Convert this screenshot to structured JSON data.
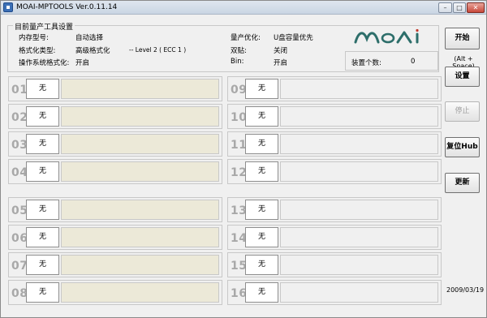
{
  "window": {
    "title": "MOAI-MPTOOLS Ver.0.11.14",
    "controls": [
      "minimize",
      "maximize",
      "close"
    ]
  },
  "settings": {
    "group_title": "目前量产工具设置",
    "memory_type_label": "内存型号:",
    "memory_type_value": "自动选择",
    "format_type_label": "格式化类型:",
    "format_type_value": "高级格式化",
    "level_value": "-- Level 2 ( ECC 1 )",
    "os_format_label": "操作系统格式化:",
    "os_format_value": "开启",
    "optimize_label": "量产优化:",
    "optimize_value": "U盘容量优先",
    "dual_label": "双贴:",
    "dual_value": "关闭",
    "bin_label": "Bin:",
    "bin_value": "开启"
  },
  "logo_text": "moai",
  "device_count": {
    "label": "装置个数:",
    "value": "0"
  },
  "buttons": {
    "start": "开始",
    "start_hint": "(Alt + Space)",
    "settings": "设置",
    "stop": "停止",
    "reset_hub": "复位Hub",
    "update": "更新"
  },
  "date": "2009/03/19",
  "accent": {
    "progress_bg": "#ece9d8",
    "stop_disabled": "#a0a0a0"
  },
  "slots": [
    {
      "num": "01",
      "status": "无"
    },
    {
      "num": "02",
      "status": "无"
    },
    {
      "num": "03",
      "status": "无"
    },
    {
      "num": "04",
      "status": "无"
    },
    {
      "num": "05",
      "status": "无"
    },
    {
      "num": "06",
      "status": "无"
    },
    {
      "num": "07",
      "status": "无"
    },
    {
      "num": "08",
      "status": "无"
    },
    {
      "num": "09",
      "status": "无"
    },
    {
      "num": "10",
      "status": "无"
    },
    {
      "num": "11",
      "status": "无"
    },
    {
      "num": "12",
      "status": "无"
    },
    {
      "num": "13",
      "status": "无"
    },
    {
      "num": "14",
      "status": "无"
    },
    {
      "num": "15",
      "status": "无"
    },
    {
      "num": "16",
      "status": "无"
    }
  ]
}
